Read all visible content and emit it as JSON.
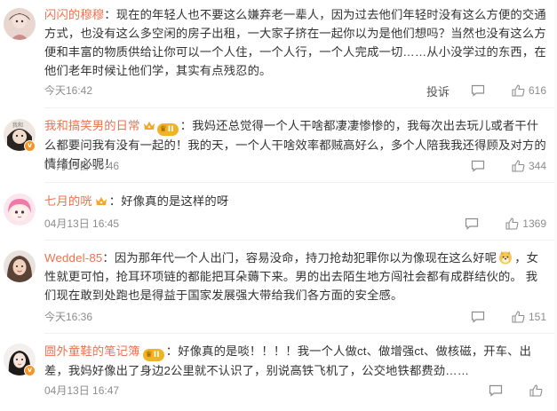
{
  "comments": [
    {
      "username": "闪闪的穆穆",
      "has_crown": false,
      "has_level": false,
      "verified": false,
      "text": "现在的年轻人也不要这么嫌弃老一辈人，因为过去他们年轻时没有这么方便的交通方式，也没有这么多空闲的房子出租，一大家子挤在一起你以为是他们想吗？当然也没有这么方便和丰富的物质供给让你可以一个人住，一个人行，一个人完成一切……从小没学过的东西，在他们老年时候让他们学，其实有点残忍的。",
      "time": "今天16:42",
      "report_label": "投诉",
      "likes": "616"
    },
    {
      "username": "我和搞笑男的日常",
      "has_crown": true,
      "has_level": true,
      "verified": true,
      "text": "我妈还总觉得一个人干啥都凄凄惨惨的，我每次出去玩儿或者干什么都要问我有没有一起的！我的天，一个人干啥效率都贼高好么，多个人陪我我还得顾及对方的情绪何必呢！",
      "time": "04月13日 16:46",
      "likes": "344"
    },
    {
      "username": "七月的咣",
      "has_crown": true,
      "has_level": false,
      "verified": false,
      "text": "好像真的是这样的呀",
      "time": "04月13日 16:45",
      "likes": "1369"
    },
    {
      "username": "Weddel-85",
      "has_crown": false,
      "has_level": false,
      "verified": false,
      "text_before_emoji": "因为那年代一个人出门，容易没命，持刀抢劫犯罪你以为像现在这么好呢",
      "emoji": "doge-emoji",
      "text_after_emoji": "，女性就更可怕，抢耳环项链的都能把耳朵薅下来。男的出去陌生地方闯社会都有成群结伙的。 我们现在敢到处跑也是得益于国家发展强大带给我们各方面的安全感。",
      "time": "今天16:36",
      "likes": "151"
    },
    {
      "username": "圆外童鞋的笔记簿",
      "has_crown": false,
      "has_level": true,
      "verified": true,
      "text": "好像真的是啖！！！！我一个人做ct、做增强ct、做核磁，开车、出差，我妈好像出了身边2公里就不认识了，别说高铁飞机了，公交地铁都费劲……",
      "time": "04月13日 16:47",
      "likes": ""
    }
  ],
  "colors": {
    "username": "#eb7350",
    "text": "#333333",
    "meta": "#8c8c8c",
    "level_badge": "#f0b324",
    "verified_badge": "#f79426"
  }
}
